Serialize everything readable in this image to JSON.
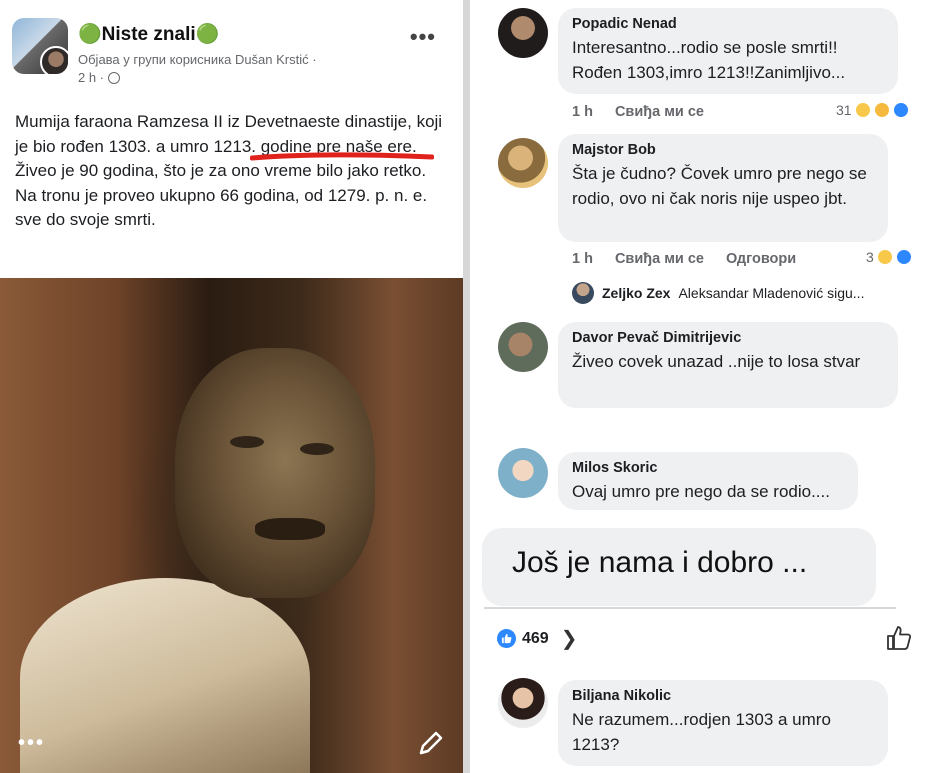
{
  "post": {
    "group_name": "🟢Niste znali🟢",
    "shared_line": "Објава у групи корисника Dušan Krstić ·",
    "time": "2 h ·",
    "text": "Mumija faraona Ramzesa II iz Devetnaeste dinastije, koji je bio rođen 1303. a umro 1213. godine pre naše ere. Živeo je 90 godina, što je za ono vreme bilo jako retko. Na tronu je proveo ukupno 66 godina, od 1279. p. n. e. sve do svoje smrti.",
    "more_label": "•••",
    "photo_more_label": "•••"
  },
  "comments": [
    {
      "name": "Popadic Nenad",
      "text": "Interesantno...rodio se posle smrti!! Rođen 1303,imro 1213!!Zanimljivo...",
      "time": "1 h",
      "like_label": "Свиђа ми се",
      "reaction_count": "31"
    },
    {
      "name": "Majstor Bob",
      "text": "Šta je čudno? Čovek umro pre nego se rodio, ovo ni čak noris nije uspeo jbt.",
      "time": "1 h",
      "like_label": "Свиђа ми се",
      "reply_label": "Одговори",
      "reaction_count": "3",
      "reply_preview_name": "Zeljko Zex",
      "reply_preview_text": "Aleksandar Mladenović sigu..."
    },
    {
      "name": "Davor Pevač Dimitrijevic",
      "text": "Živeo covek unazad ..nije to losa stvar"
    },
    {
      "name": "Milos Skoric",
      "text": "Ovaj umro pre nego da se rodio...."
    },
    {
      "name": "Biljana Nikolic",
      "text": "Ne razumem...rodjen 1303    a umro 1213?"
    }
  ],
  "big_card": {
    "text": "Još je nama i dobro ..."
  },
  "likes": {
    "count": "469"
  },
  "colors": {
    "accent_blue": "#2d88ff",
    "underline_red": "#e0221c",
    "bubble_bg": "#eff0f2"
  }
}
